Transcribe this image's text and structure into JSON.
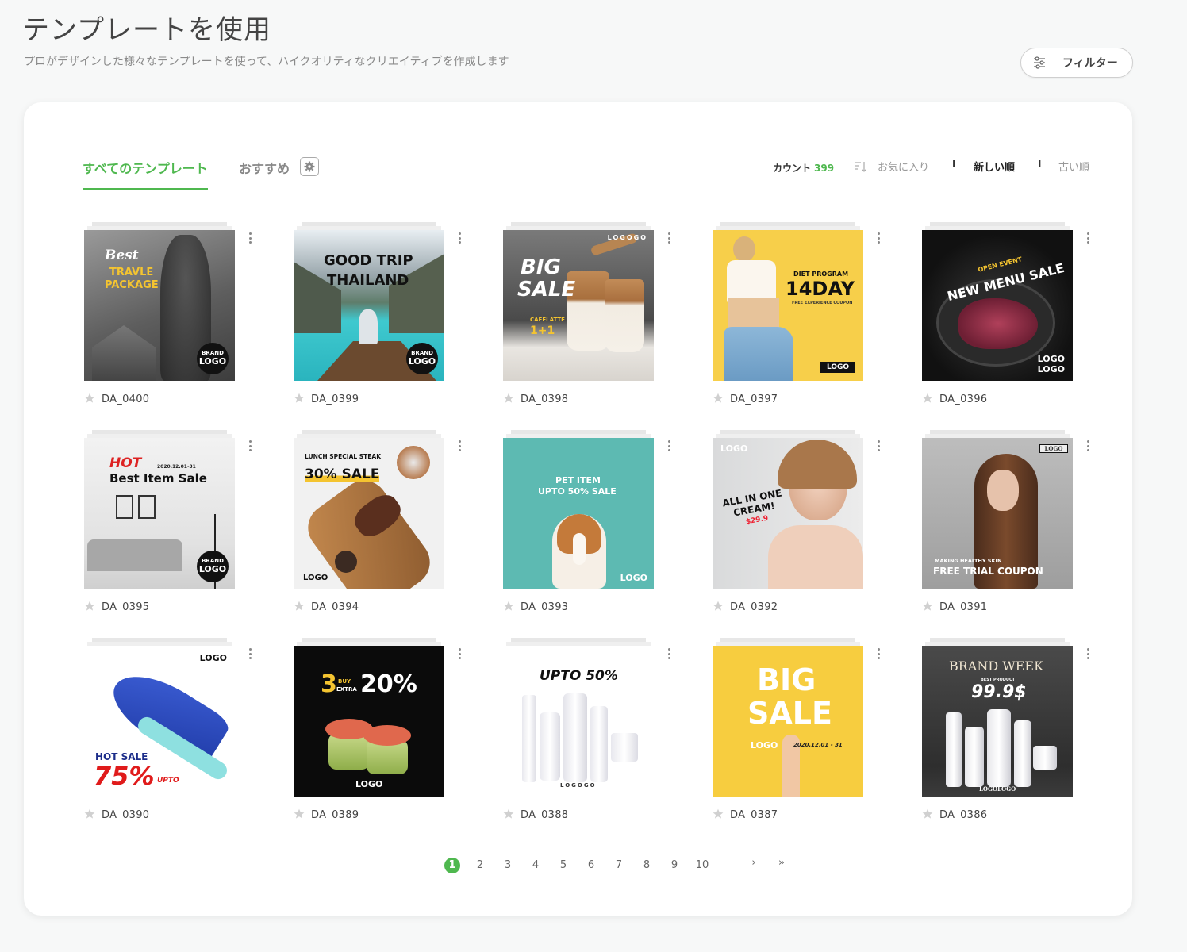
{
  "header": {
    "title": "テンプレートを使用",
    "subtitle": "プロがデザインした様々なテンプレートを使って、ハイクオリティなクリエイティブを作成します",
    "filter_label": "フィルター"
  },
  "tabs": {
    "all": "すべてのテンプレート",
    "recommended": "おすすめ"
  },
  "toolbar": {
    "count_label": "カウント",
    "count_value": "399",
    "sort_favorite": "お気に入り",
    "separator": "I",
    "sort_newest": "新しい順",
    "sort_oldest": "古い順"
  },
  "templates": [
    {
      "code": "DA_0400",
      "lines": [
        "Best",
        "TRAVLE",
        "PACKAGE"
      ],
      "badge": [
        "BRAND",
        "LOGO"
      ]
    },
    {
      "code": "DA_0399",
      "lines": [
        "GOOD TRIP",
        "THAILAND"
      ],
      "badge": [
        "BRAND",
        "LOGO"
      ]
    },
    {
      "code": "DA_0398",
      "lines": [
        "BIG",
        "SALE",
        "CAFELATTE",
        "1+1",
        "LOGOGO"
      ]
    },
    {
      "code": "DA_0397",
      "lines": [
        "DIET PROGRAM",
        "14DAY",
        "FREE EXPERIENCE COUPON",
        "LOGO"
      ]
    },
    {
      "code": "DA_0396",
      "lines": [
        "OPEN EVENT",
        "NEW MENU SALE",
        "LOGO",
        "LOGO"
      ]
    },
    {
      "code": "DA_0395",
      "lines": [
        "HOT",
        "2020.12.01-31",
        "Best Item Sale"
      ],
      "badge": [
        "BRAND",
        "LOGO"
      ]
    },
    {
      "code": "DA_0394",
      "lines": [
        "LUNCH SPECIAL STEAK",
        "30% SALE",
        "LOGO"
      ]
    },
    {
      "code": "DA_0393",
      "lines": [
        "PET ITEM",
        "UPTO 50% SALE",
        "LOGO"
      ]
    },
    {
      "code": "DA_0392",
      "lines": [
        "LOGO",
        "ALL IN ONE",
        "CREAM!",
        "$29.9"
      ]
    },
    {
      "code": "DA_0391",
      "lines": [
        "LOGO",
        "MAKING HEALTHY SKIN",
        "FREE TRIAL COUPON"
      ]
    },
    {
      "code": "DA_0390",
      "lines": [
        "LOGO",
        "HOT SALE",
        "75%",
        "UPTO"
      ]
    },
    {
      "code": "DA_0389",
      "lines": [
        "3",
        "BUY",
        "EXTRA",
        "20%",
        "LOGO"
      ]
    },
    {
      "code": "DA_0388",
      "lines": [
        "UPTO 50%",
        "LOGOGO"
      ]
    },
    {
      "code": "DA_0387",
      "lines": [
        "BIG",
        "SALE",
        "LOGO",
        "2020.12.01 - 31"
      ]
    },
    {
      "code": "DA_0386",
      "lines": [
        "BRAND WEEK",
        "BEST PRODUCT",
        "99.9$",
        "LOGOLOGO"
      ]
    }
  ],
  "pagination": {
    "pages": [
      "1",
      "2",
      "3",
      "4",
      "5",
      "6",
      "7",
      "8",
      "9",
      "10"
    ],
    "next": "›",
    "last": "»",
    "active": 1
  },
  "colors": {
    "accent": "#4fb84f",
    "background": "#f7f8f8",
    "card": "#ffffff"
  }
}
